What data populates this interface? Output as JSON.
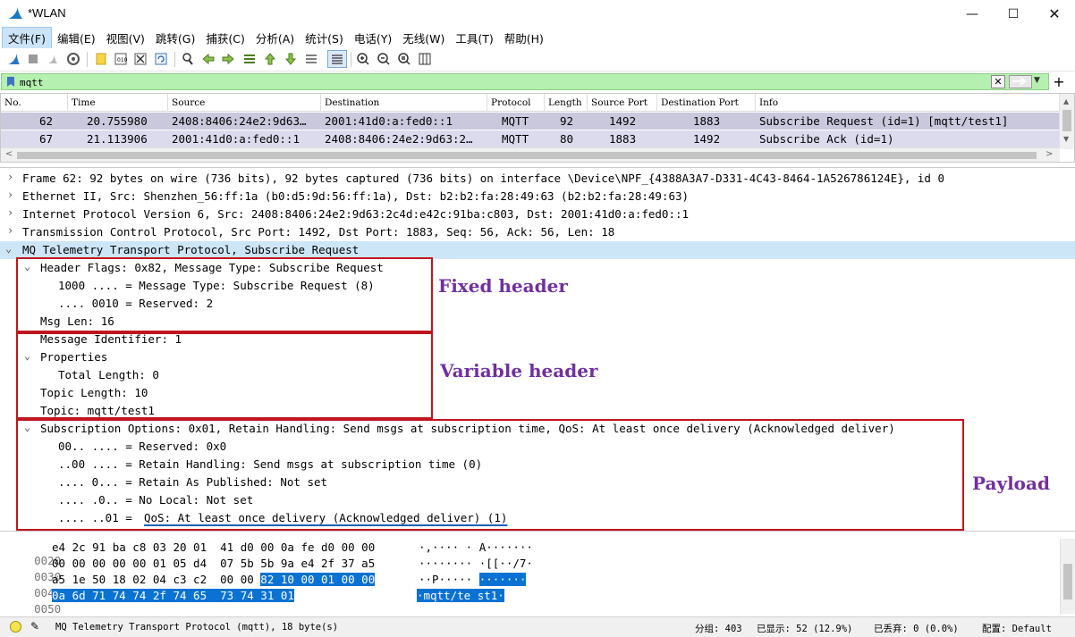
{
  "window": {
    "title": "*WLAN"
  },
  "menu": [
    "文件(F)",
    "编辑(E)",
    "视图(V)",
    "跳转(G)",
    "捕获(C)",
    "分析(A)",
    "统计(S)",
    "电话(Y)",
    "无线(W)",
    "工具(T)",
    "帮助(H)"
  ],
  "filter": {
    "value": "mqtt"
  },
  "packet_list": {
    "columns": [
      "No.",
      "Time",
      "Source",
      "Destination",
      "Protocol",
      "Length",
      "Source Port",
      "Destination Port",
      "Info"
    ],
    "rows": [
      {
        "no": "62",
        "time": "20.755980",
        "source": "2408:8406:24e2:9d63…",
        "destination": "2001:41d0:a:fed0::1",
        "protocol": "MQTT",
        "length": "92",
        "sport": "1492",
        "dport": "1883",
        "info": "Subscribe Request (id=1) [mqtt/test1]"
      },
      {
        "no": "67",
        "time": "21.113906",
        "source": "2001:41d0:a:fed0::1",
        "destination": "2408:8406:24e2:9d63:2…",
        "protocol": "MQTT",
        "length": "80",
        "sport": "1883",
        "dport": "1492",
        "info": "Subscribe Ack (id=1)"
      }
    ]
  },
  "details": {
    "frame": "Frame 62: 92 bytes on wire (736 bits), 92 bytes captured (736 bits) on interface \\Device\\NPF_{4388A3A7-D331-4C43-8464-1A526786124E}, id 0",
    "ethernet": "Ethernet II, Src: Shenzhen_56:ff:1a (b0:d5:9d:56:ff:1a), Dst: b2:b2:fa:28:49:63 (b2:b2:fa:28:49:63)",
    "ipv6": "Internet Protocol Version 6, Src: 2408:8406:24e2:9d63:2c4d:e42c:91ba:c803, Dst: 2001:41d0:a:fed0::1",
    "tcp": "Transmission Control Protocol, Src Port: 1492, Dst Port: 1883, Seq: 56, Ack: 56, Len: 18",
    "mqtt": "MQ Telemetry Transport Protocol, Subscribe Request",
    "header_flags": "Header Flags: 0x82, Message Type: Subscribe Request",
    "msg_type": "1000 .... = Message Type: Subscribe Request (8)",
    "reserved": ".... 0010 = Reserved: 2",
    "msg_len": "Msg Len: 16",
    "msg_id": "Message Identifier: 1",
    "properties": "Properties",
    "total_length": "Total Length: 0",
    "topic_length": "Topic Length: 10",
    "topic": "Topic: mqtt/test1",
    "sub_options": "Subscription Options: 0x01, Retain Handling: Send msgs at subscription time, QoS: At least once delivery (Acknowledged deliver)",
    "opt_reserved": "00.. .... = Reserved: 0x0",
    "opt_retain_handling": "..00 .... = Retain Handling: Send msgs at subscription time (0)",
    "opt_rap": ".... 0... = Retain As Published: Not set",
    "opt_nolocal": ".... .0.. = No Local: Not set",
    "opt_qos_prefix": ".... ..01 = ",
    "opt_qos": "QoS: At least once delivery (Acknowledged deliver) (1)"
  },
  "annotations": {
    "fixed": "Fixed header",
    "variable": "Variable header",
    "payload": "Payload"
  },
  "bytes": [
    {
      "offset": "0020",
      "hex": "e4 2c 91 ba c8 03 20 01  41 d0 00 0a fe d0 00 00",
      "hex_hl": "",
      "ascii": "·,···· · A·······",
      "ascii_hl": ""
    },
    {
      "offset": "0030",
      "hex": "00 00 00 00 00 01 05 d4  07 5b 5b 9a e4 2f 37 a5",
      "hex_hl": "",
      "ascii": "········ ·[[··/7·",
      "ascii_hl": ""
    },
    {
      "offset": "0040",
      "hex": "a5 1e 50 18 02 04 c3 c2  00 00 ",
      "hex_hl": "82 10 00 01 00 00",
      "ascii": "··P····· ",
      "ascii_hl": "·······"
    },
    {
      "offset": "0050",
      "hex": "",
      "hex_hl": "0a 6d 71 74 74 2f 74 65  73 74 31 01",
      "ascii": "",
      "ascii_hl": "·mqtt/te st1·"
    }
  ],
  "status": {
    "field": "MQ Telemetry Transport Protocol (mqtt), 18 byte(s)",
    "packets": "分组: 403",
    "displayed": "已显示: 52 (12.9%)",
    "dropped": "已丢弃: 0 (0.0%)",
    "profile": "配置: Default"
  }
}
